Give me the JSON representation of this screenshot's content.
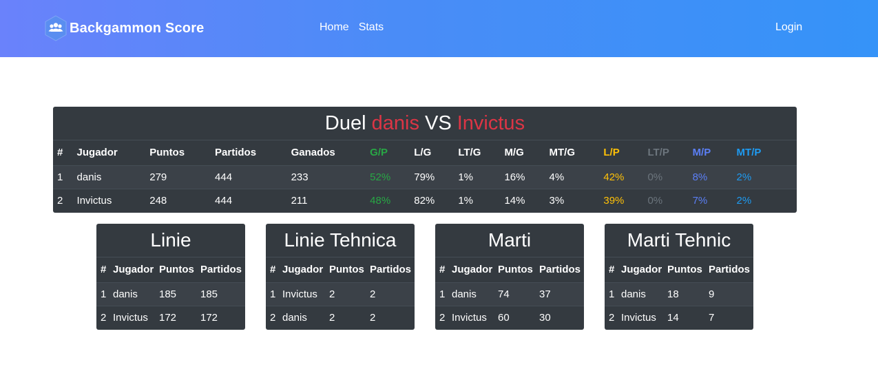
{
  "header": {
    "brand": "Backgammon Score",
    "brand_icon": "users-icon",
    "nav": [
      {
        "label": "Home"
      },
      {
        "label": "Stats"
      }
    ],
    "login": "Login",
    "gradient": [
      "#6a82fb",
      "#3593f8"
    ]
  },
  "duel": {
    "title_prefix": "Duel ",
    "player1": "danis",
    "vs": " VS ",
    "player2": "Invictus",
    "columns": [
      "#",
      "Jugador",
      "Puntos",
      "Partidos",
      "Ganados",
      "G/P",
      "L/G",
      "LT/G",
      "M/G",
      "MT/G",
      "L/P",
      "LT/P",
      "M/P",
      "MT/P"
    ],
    "rows": [
      [
        "1",
        "danis",
        "279",
        "444",
        "233",
        "52%",
        "79%",
        "1%",
        "16%",
        "4%",
        "42%",
        "0%",
        "8%",
        "2%"
      ],
      [
        "2",
        "Invictus",
        "248",
        "444",
        "211",
        "48%",
        "82%",
        "1%",
        "14%",
        "3%",
        "39%",
        "0%",
        "7%",
        "2%"
      ]
    ]
  },
  "tables": [
    {
      "title": "Linie",
      "columns": [
        "#",
        "Jugador",
        "Puntos",
        "Partidos"
      ],
      "rows": [
        [
          "1",
          "danis",
          "185",
          "185"
        ],
        [
          "2",
          "Invictus",
          "172",
          "172"
        ]
      ]
    },
    {
      "title": "Linie Tehnica",
      "columns": [
        "#",
        "Jugador",
        "Puntos",
        "Partidos"
      ],
      "rows": [
        [
          "1",
          "Invictus",
          "2",
          "2"
        ],
        [
          "2",
          "danis",
          "2",
          "2"
        ]
      ]
    },
    {
      "title": "Marti",
      "columns": [
        "#",
        "Jugador",
        "Puntos",
        "Partidos"
      ],
      "rows": [
        [
          "1",
          "danis",
          "74",
          "37"
        ],
        [
          "2",
          "Invictus",
          "60",
          "30"
        ]
      ]
    },
    {
      "title": "Marti Tehnic",
      "columns": [
        "#",
        "Jugador",
        "Puntos",
        "Partidos"
      ],
      "rows": [
        [
          "1",
          "danis",
          "18",
          "9"
        ],
        [
          "2",
          "Invictus",
          "14",
          "7"
        ]
      ]
    }
  ],
  "colors": {
    "table_bg": "#343a40",
    "player_name": "#dc3545",
    "gp": "#28a745",
    "lp": "#ffc107",
    "ltp": "#6c757d",
    "mp": "#5b7ff6",
    "mtp": "#1e9bf2"
  }
}
